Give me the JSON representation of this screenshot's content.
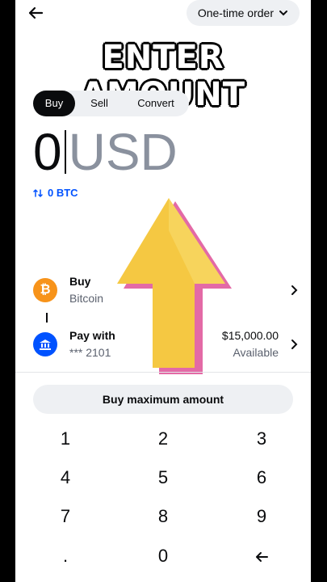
{
  "header": {
    "order_label": "One-time order"
  },
  "banner": {
    "text": "ENTER AMOUNT"
  },
  "tabs": [
    {
      "label": "Buy"
    },
    {
      "label": "Sell"
    },
    {
      "label": "Convert"
    }
  ],
  "amount": {
    "value": "0",
    "currency": "USD"
  },
  "conversion": {
    "text": "0 BTC"
  },
  "buy_row": {
    "title": "Buy",
    "subtitle": "Bitcoin",
    "icon": "bitcoin-icon",
    "color": "#f7931a"
  },
  "pay_row": {
    "title": "Pay with",
    "subtitle": "*** 2101",
    "balance": "$15,000.00",
    "balance_label": "Available",
    "icon": "bank-icon",
    "color": "#0052ff"
  },
  "max_button": {
    "label": "Buy maximum amount"
  },
  "keypad": [
    "1",
    "2",
    "3",
    "4",
    "5",
    "6",
    "7",
    "8",
    "9",
    ".",
    "0"
  ],
  "colors": {
    "accent": "#0052ff",
    "text": "#0a0b0d",
    "muted": "#5b616e",
    "arrow": "#f5c842",
    "arrow_edge": "#e36aa6"
  }
}
